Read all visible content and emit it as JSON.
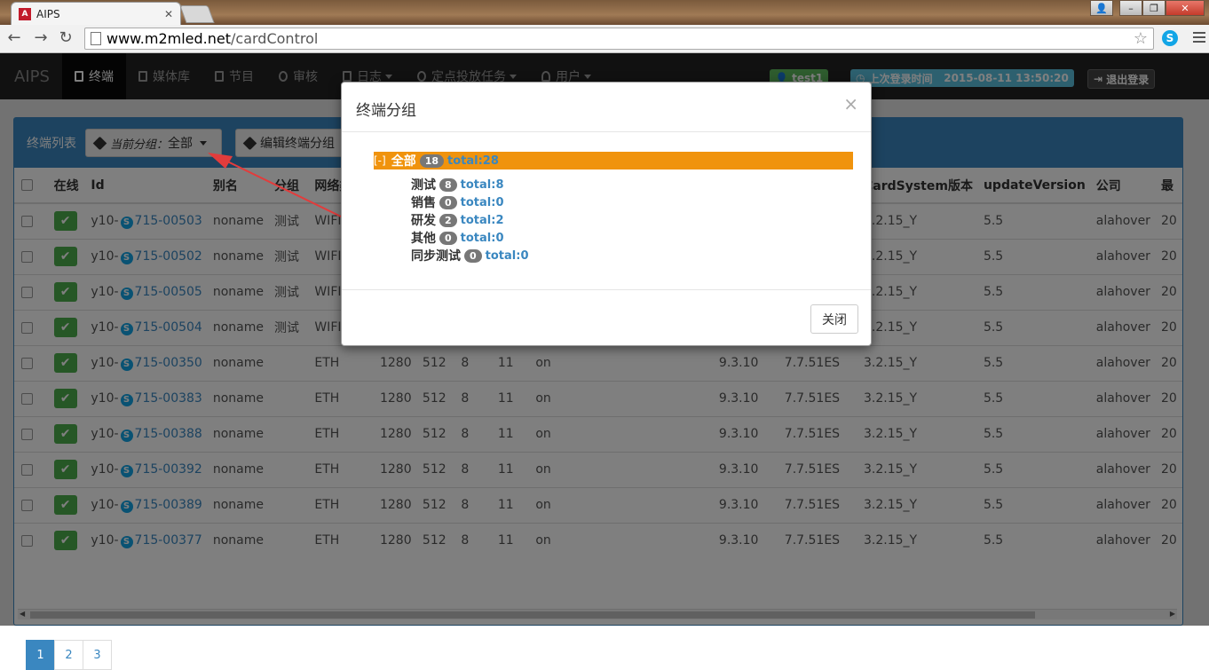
{
  "browser": {
    "tab_title": "AIPS",
    "url_host": "www.m2mled.net",
    "url_path": "/cardControl"
  },
  "navbar": {
    "brand": "AIPS",
    "items": [
      {
        "label": "终端",
        "active": true
      },
      {
        "label": "媒体库"
      },
      {
        "label": "节目"
      },
      {
        "label": "审核"
      },
      {
        "label": "日志"
      },
      {
        "label": "定点投放任务"
      },
      {
        "label": "用户"
      }
    ],
    "user": "test1",
    "last_login_label": "上次登录时间",
    "last_login_time": "2015-08-11 13:50:20",
    "logout": "退出登录"
  },
  "panel": {
    "title": "终端列表",
    "group_button_prefix": "当前分组：",
    "group_button_value": "全部",
    "edit_group_button": "编辑终端分组"
  },
  "table": {
    "columns": [
      "在线",
      "Id",
      "别名",
      "分组",
      "网络类",
      "CardSystem版本",
      "updateVersion",
      "公司",
      "最"
    ],
    "rows": [
      {
        "id_prefix": "y10-",
        "id": "715-00503",
        "alias": "noname",
        "group": "测试",
        "net": "WIFI",
        "c1": "",
        "c2": "",
        "c3": "",
        "c4": "",
        "c5": "",
        "v1": "",
        "v2": "",
        "cs": "3.2.15_Y",
        "uv": "5.5",
        "co": "alahover",
        "last": "20"
      },
      {
        "id_prefix": "y10-",
        "id": "715-00502",
        "alias": "noname",
        "group": "测试",
        "net": "WIFI",
        "c1": "",
        "c2": "",
        "c3": "",
        "c4": "",
        "c5": "",
        "v1": "",
        "v2": "",
        "cs": "3.2.15_Y",
        "uv": "5.5",
        "co": "alahover",
        "last": "20"
      },
      {
        "id_prefix": "y10-",
        "id": "715-00505",
        "alias": "noname",
        "group": "测试",
        "net": "WIFI",
        "c1": "",
        "c2": "",
        "c3": "",
        "c4": "",
        "c5": "",
        "v1": "",
        "v2": "",
        "cs": "3.2.15_Y",
        "uv": "5.5",
        "co": "alahover",
        "last": "20"
      },
      {
        "id_prefix": "y10-",
        "id": "715-00504",
        "alias": "noname",
        "group": "测试",
        "net": "WIFI",
        "c1": "",
        "c2": "",
        "c3": "",
        "c4": "",
        "c5": "",
        "v1": "",
        "v2": "",
        "cs": "3.2.15_Y",
        "uv": "5.5",
        "co": "alahover",
        "last": "20"
      },
      {
        "id_prefix": "y10-",
        "id": "715-00350",
        "alias": "noname",
        "group": "",
        "net": "ETH",
        "c1": "1280",
        "c2": "512",
        "c3": "8",
        "c4": "11",
        "c5": "on",
        "v1": "9.3.10",
        "v2": "7.7.51ES",
        "cs": "3.2.15_Y",
        "uv": "5.5",
        "co": "alahover",
        "last": "20"
      },
      {
        "id_prefix": "y10-",
        "id": "715-00383",
        "alias": "noname",
        "group": "",
        "net": "ETH",
        "c1": "1280",
        "c2": "512",
        "c3": "8",
        "c4": "11",
        "c5": "on",
        "v1": "9.3.10",
        "v2": "7.7.51ES",
        "cs": "3.2.15_Y",
        "uv": "5.5",
        "co": "alahover",
        "last": "20"
      },
      {
        "id_prefix": "y10-",
        "id": "715-00388",
        "alias": "noname",
        "group": "",
        "net": "ETH",
        "c1": "1280",
        "c2": "512",
        "c3": "8",
        "c4": "11",
        "c5": "on",
        "v1": "9.3.10",
        "v2": "7.7.51ES",
        "cs": "3.2.15_Y",
        "uv": "5.5",
        "co": "alahover",
        "last": "20"
      },
      {
        "id_prefix": "y10-",
        "id": "715-00392",
        "alias": "noname",
        "group": "",
        "net": "ETH",
        "c1": "1280",
        "c2": "512",
        "c3": "8",
        "c4": "11",
        "c5": "on",
        "v1": "9.3.10",
        "v2": "7.7.51ES",
        "cs": "3.2.15_Y",
        "uv": "5.5",
        "co": "alahover",
        "last": "20"
      },
      {
        "id_prefix": "y10-",
        "id": "715-00389",
        "alias": "noname",
        "group": "",
        "net": "ETH",
        "c1": "1280",
        "c2": "512",
        "c3": "8",
        "c4": "11",
        "c5": "on",
        "v1": "9.3.10",
        "v2": "7.7.51ES",
        "cs": "3.2.15_Y",
        "uv": "5.5",
        "co": "alahover",
        "last": "20"
      },
      {
        "id_prefix": "y10-",
        "id": "715-00377",
        "alias": "noname",
        "group": "",
        "net": "ETH",
        "c1": "1280",
        "c2": "512",
        "c3": "8",
        "c4": "11",
        "c5": "on",
        "v1": "9.3.10",
        "v2": "7.7.51ES",
        "cs": "3.2.15_Y",
        "uv": "5.5",
        "co": "alahover",
        "last": "20"
      }
    ]
  },
  "pagination": [
    "1",
    "2",
    "3"
  ],
  "modal": {
    "title": "终端分组",
    "close_x": "×",
    "root": {
      "toggle": "[-]",
      "name": "全部",
      "count": "18",
      "total": "total:28"
    },
    "children": [
      {
        "name": "测试",
        "count": "8",
        "total": "total:8"
      },
      {
        "name": "销售",
        "count": "0",
        "total": "total:0"
      },
      {
        "name": "研发",
        "count": "2",
        "total": "total:2"
      },
      {
        "name": "其他",
        "count": "0",
        "total": "total:0"
      },
      {
        "name": "同步测试",
        "count": "0",
        "total": "total:0"
      }
    ],
    "close_button": "关闭"
  },
  "colors": {
    "accent": "#3a87c0",
    "highlight": "#f0930d",
    "online": "#4cae4c",
    "user_label": "#5cb85c",
    "login_label": "#5bc0de"
  }
}
